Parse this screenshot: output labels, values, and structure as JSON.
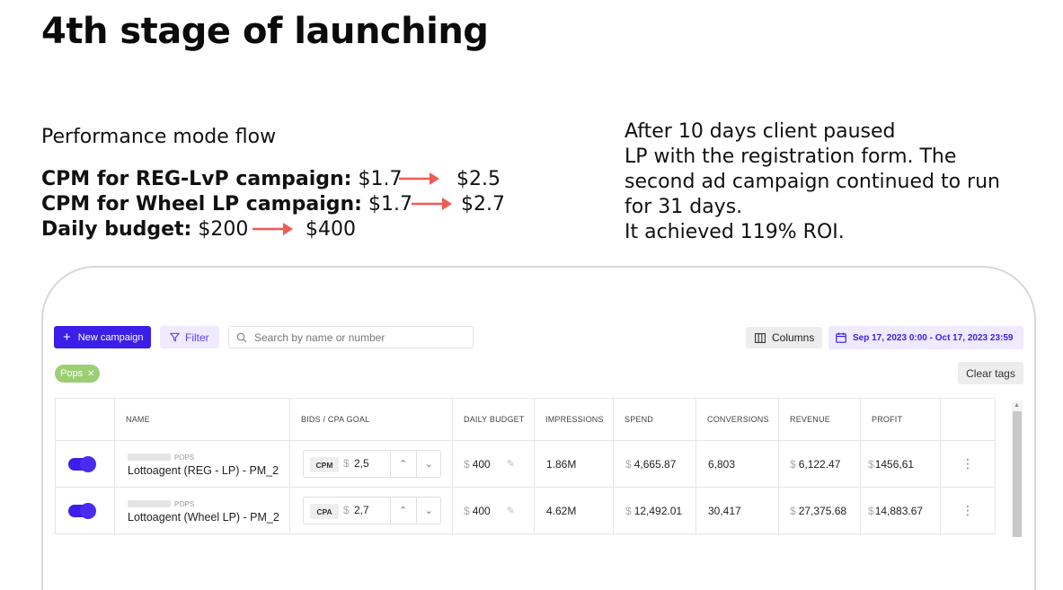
{
  "slide": {
    "title": "4th stage of launching",
    "flow_heading": "Performance mode flow",
    "flow_lines": [
      {
        "label": "CPM for REG-LvP campaign:",
        "from": "$1.7",
        "to": "$2.5"
      },
      {
        "label": "CPM for Wheel LP campaign:",
        "from": "$1.7",
        "to": "$2.7"
      },
      {
        "label": "Daily budget:",
        "from": "$200",
        "to": "$400"
      }
    ],
    "note": "After 10 days client paused\nLP with the registration form. The\nsecond ad campaign continued to run\nfor 31 days.\nIt achieved 119% ROI.",
    "arrow_color": "#ef5b57"
  },
  "toolbar": {
    "new_campaign": "New campaign",
    "filter": "Filter",
    "search_placeholder": "Search by name or number",
    "columns": "Columns",
    "date_range": "Sep 17, 2023 0:00 - Oct 17, 2023 23:59"
  },
  "tags": {
    "active": "Pops",
    "clear": "Clear tags"
  },
  "table": {
    "headers": {
      "name": "NAME",
      "bids": "BIDS / CPA GOAL",
      "daily_budget": "DAILY BUDGET",
      "impressions": "IMPRESSIONS",
      "spend": "SPEND",
      "conversions": "CONVERSIONS",
      "revenue": "REVENUE",
      "profit": "PROFIT"
    },
    "rows": [
      {
        "status_on": true,
        "tag": "POPS",
        "name": "Lottoagent (REG - LP) - PM_2",
        "bid_type": "CPM",
        "bid_value": "2,5",
        "daily_budget": "400",
        "impressions": "1.86M",
        "spend": "4,665.87",
        "conversions": "6,803",
        "revenue": "6,122.47",
        "profit": "1456,61"
      },
      {
        "status_on": true,
        "tag": "POPS",
        "name": "Lottoagent (Wheel LP) - PM_2",
        "bid_type": "CPA",
        "bid_value": "2,7",
        "daily_budget": "400",
        "impressions": "4.62M",
        "spend": "12,492.01",
        "conversions": "30,417",
        "revenue": "27,375.68",
        "profit": "14,883.67"
      }
    ]
  },
  "symbols": {
    "dollar": "$",
    "plus": "+",
    "close": "✕",
    "kebab": "⋮",
    "pencil": "✎",
    "up": "⌃",
    "down": "⌄"
  },
  "colors": {
    "primary": "#3b1fe8",
    "accent_light": "#efeaff",
    "tag_green": "#9ccf73"
  }
}
